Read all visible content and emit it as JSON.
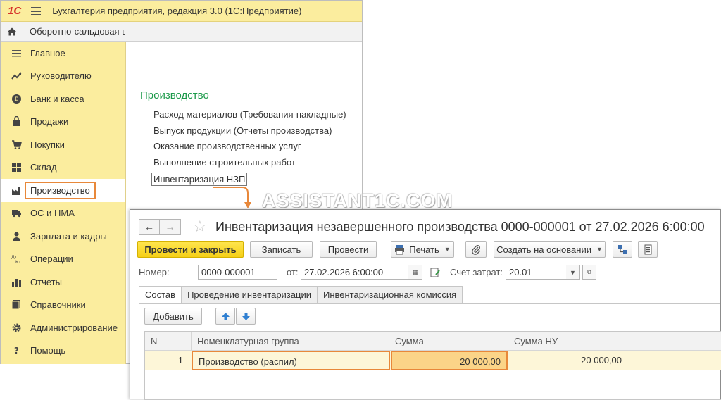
{
  "app": {
    "logo": "1С",
    "title": "Бухгалтерия предприятия, редакция 3.0  (1С:Предприятие)",
    "open_tab": "Оборотно-сальдовая в"
  },
  "sidebar": {
    "items": [
      {
        "label": "Главное",
        "icon": "menu-lines-icon"
      },
      {
        "label": "Руководителю",
        "icon": "trend-up-icon"
      },
      {
        "label": "Банк и касса",
        "icon": "coin-icon"
      },
      {
        "label": "Продажи",
        "icon": "shopping-bag-icon"
      },
      {
        "label": "Покупки",
        "icon": "cart-icon"
      },
      {
        "label": "Склад",
        "icon": "grid-blocks-icon"
      },
      {
        "label": "Производство",
        "icon": "factory-icon"
      },
      {
        "label": "ОС и НМА",
        "icon": "truck-icon"
      },
      {
        "label": "Зарплата и кадры",
        "icon": "person-icon"
      },
      {
        "label": "Операции",
        "icon": "dt-kt-icon"
      },
      {
        "label": "Отчеты",
        "icon": "bar-chart-icon"
      },
      {
        "label": "Справочники",
        "icon": "books-icon"
      },
      {
        "label": "Администрирование",
        "icon": "gear-icon"
      },
      {
        "label": "Помощь",
        "icon": "question-icon"
      }
    ]
  },
  "section": {
    "title": "Производство",
    "links": [
      "Расход материалов (Требования-накладные)",
      "Выпуск продукции (Отчеты производства)",
      "Оказание производственных услуг",
      "Выполнение строительных работ",
      "Инвентаризация НЗП"
    ]
  },
  "watermark": "ASSISTANT1C.COM",
  "document": {
    "title": "Инвентаризация незавершенного производства 0000-000001 от 27.02.2026 6:00:00",
    "toolbar": {
      "post_close": "Провести и закрыть",
      "save": "Записать",
      "post": "Провести",
      "print": "Печать",
      "create_based": "Создать на основании"
    },
    "fields": {
      "number_label": "Номер:",
      "number_value": "0000-000001",
      "date_label": "от:",
      "date_value": "27.02.2026  6:00:00",
      "account_label": "Счет затрат:",
      "account_value": "20.01"
    },
    "tabs": [
      "Состав",
      "Проведение инвентаризации",
      "Инвентаризационная комиссия"
    ],
    "add_button": "Добавить",
    "table": {
      "columns": [
        "N",
        "Номенклатурная группа",
        "Сумма",
        "Сумма НУ"
      ],
      "rows": [
        {
          "n": "1",
          "group": "Производство (распил)",
          "sum": "20 000,00",
          "sum_nu": "20 000,00"
        }
      ]
    }
  },
  "colors": {
    "panel_yellow": "#fbed9e",
    "highlight_orange": "#e8883a",
    "section_green": "#1c9a4a",
    "primary_button": "#f5cf17"
  }
}
